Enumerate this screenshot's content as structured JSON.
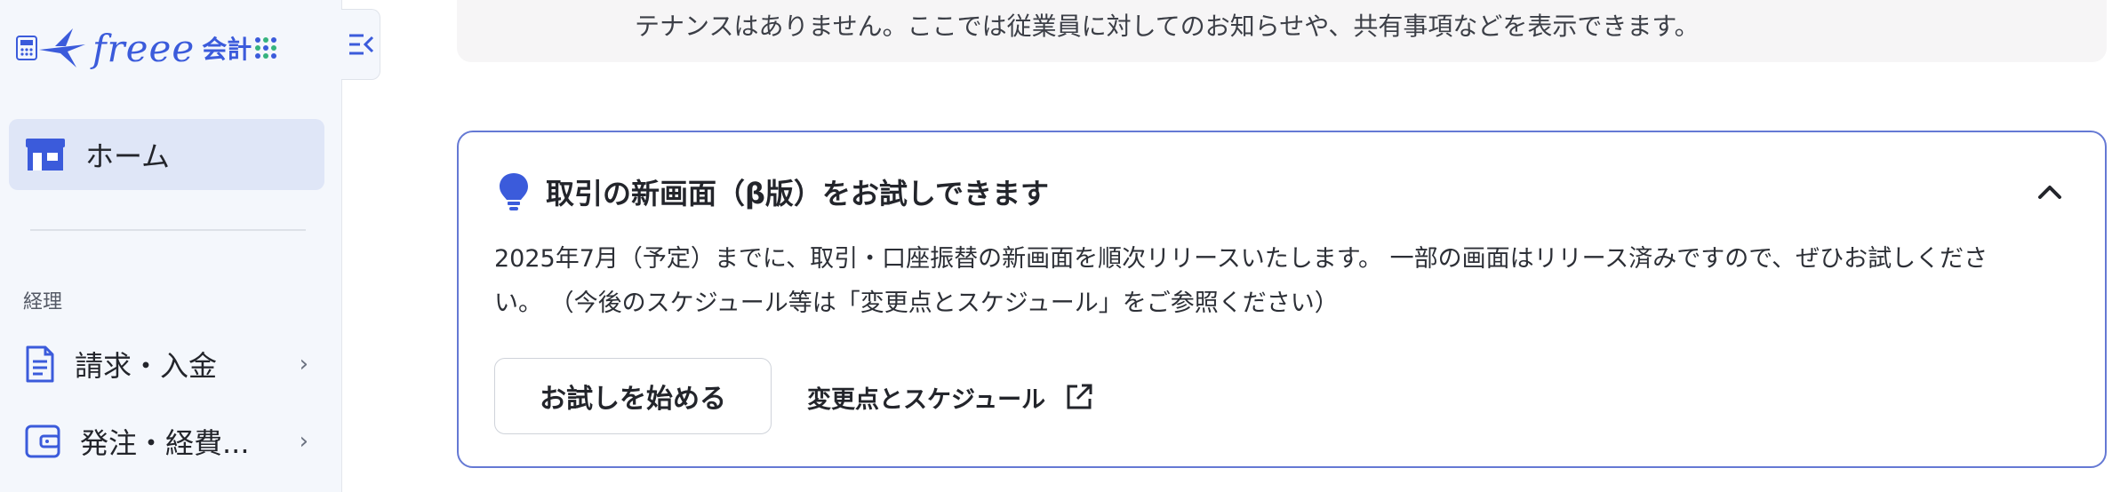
{
  "sidebar": {
    "logo_text": "freee",
    "logo_suffix": "会計",
    "home_label": "ホーム",
    "section_label": "経理",
    "items": [
      {
        "label": "請求・入金",
        "chevron": "›"
      },
      {
        "label": "発注・経費...",
        "chevron": "›"
      }
    ]
  },
  "notice": {
    "text": "テナンスはありません。ここでは従業員に対してのお知らせや、共有事項などを表示できます。"
  },
  "beta_card": {
    "title": "取引の新画面（β版）をお試しできます",
    "body_line1": "2025年7月（予定）までに、取引・口座振替の新画面を順次リリースいたします。 一部の画面はリリース済みですので、ぜひお試しくださ",
    "body_line2": "い。 （今後のスケジュール等は「変更点とスケジュール」をご参照ください）",
    "try_button": "お試しを始める",
    "schedule_link": "変更点とスケジュール"
  },
  "colors": {
    "brand": "#3b5bdb",
    "card_border": "#6579d4",
    "home_bg": "#dfe6f7",
    "notice_border": "#f3d77a"
  },
  "icons": {
    "logo": "freee-bird-logo",
    "collapse": "sidebar-collapse-icon",
    "home": "store-icon",
    "invoice": "document-icon",
    "expense": "wallet-icon",
    "tip": "lightbulb-icon",
    "caret": "chevron-up-icon",
    "external": "external-link-icon"
  }
}
